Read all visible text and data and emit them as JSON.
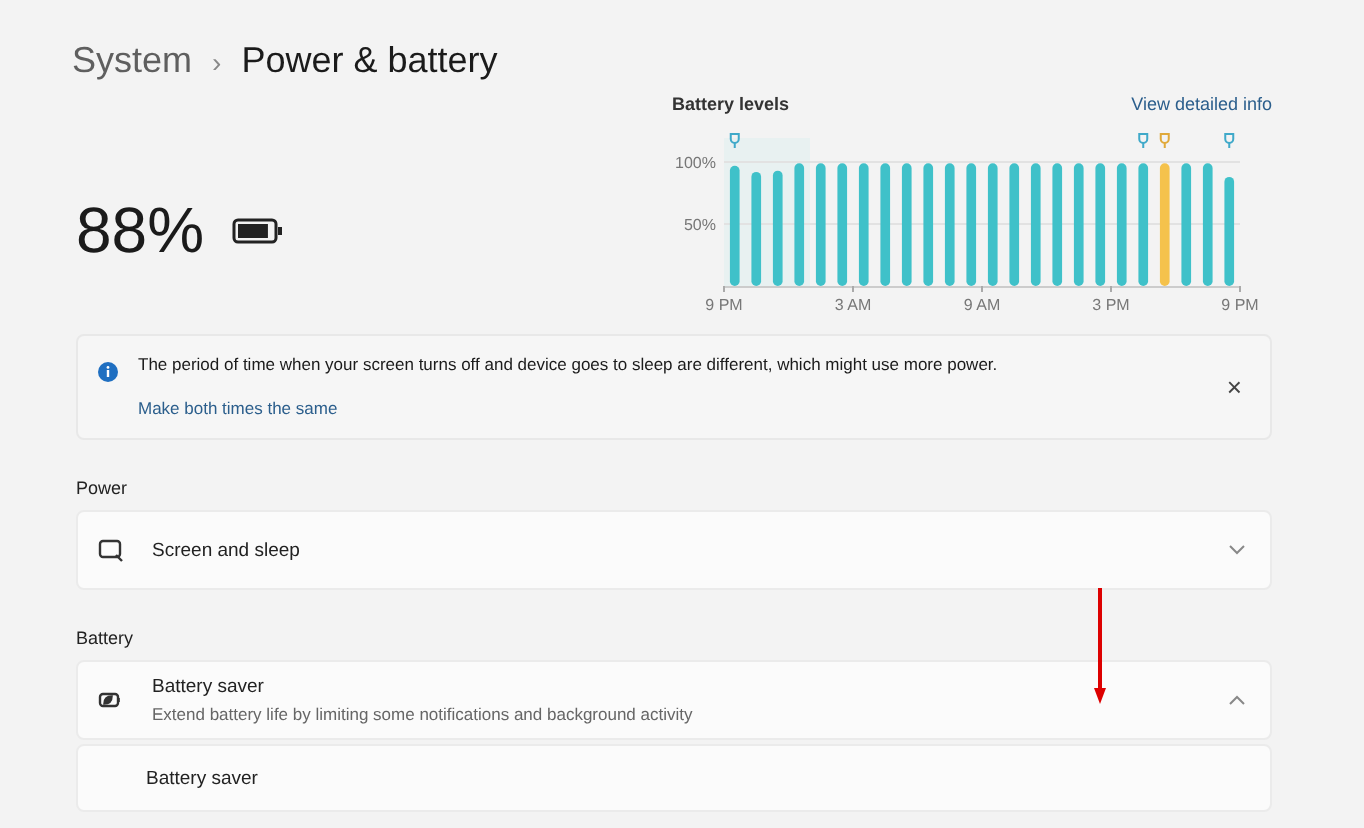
{
  "breadcrumb": {
    "parent": "System",
    "separator": "›",
    "current": "Power & battery"
  },
  "battery": {
    "percent": "88%",
    "level": 0.88
  },
  "battery_levels": {
    "title": "Battery levels",
    "link": "View detailed info",
    "chart_data": {
      "type": "bar",
      "yticks": [
        {
          "value": 50,
          "label": "50%"
        },
        {
          "value": 100,
          "label": "100%"
        }
      ],
      "ylim": [
        0,
        100
      ],
      "categories": [
        "9 PM",
        null,
        null,
        null,
        null,
        null,
        "3 AM",
        null,
        null,
        null,
        null,
        null,
        "9 AM",
        null,
        null,
        null,
        null,
        null,
        "3 PM",
        null,
        null,
        null,
        null,
        null,
        "9 PM"
      ],
      "series": [
        {
          "color": "#3fc1c9",
          "values": [
            97,
            92,
            93,
            99,
            99,
            99,
            99,
            99,
            99,
            99,
            99,
            99,
            99,
            99,
            99,
            99,
            99,
            99,
            99,
            99,
            null,
            99,
            99,
            88,
            null
          ]
        },
        {
          "color": "#f5c24c",
          "values": [
            null,
            null,
            null,
            null,
            null,
            null,
            null,
            null,
            null,
            null,
            null,
            null,
            null,
            null,
            null,
            null,
            null,
            null,
            null,
            null,
            99,
            null,
            null,
            null,
            null
          ]
        }
      ]
    },
    "bars": [
      {
        "charging": true
      },
      {
        "charging": false
      },
      {
        "charging": false
      },
      {
        "charging": false
      },
      {
        "charging": false
      },
      {
        "charging": false
      },
      {
        "charging": false
      },
      {
        "charging": false
      },
      {
        "charging": false
      },
      {
        "charging": false
      },
      {
        "charging": false
      },
      {
        "charging": false
      },
      {
        "charging": false
      },
      {
        "charging": false
      },
      {
        "charging": false
      },
      {
        "charging": false
      },
      {
        "charging": false
      },
      {
        "charging": false
      },
      {
        "charging": false
      },
      {
        "charging": true
      },
      {
        "charging": true
      },
      {
        "charging": false
      },
      {
        "charging": false
      },
      {
        "charging": true
      }
    ]
  },
  "notice": {
    "message": "The period of time when your screen turns off and device goes to sleep are different, which might use more power.",
    "action": "Make both times the same",
    "close": "×"
  },
  "sections": [
    {
      "heading": "Power",
      "rows": [
        {
          "kind": "expander",
          "title": "Screen and sleep",
          "expanded": false
        }
      ]
    },
    {
      "heading": "Battery",
      "rows": [
        {
          "kind": "expander",
          "title": "Battery saver",
          "subtitle": "Extend battery life by limiting some notifications and background activity",
          "expanded": true
        },
        {
          "kind": "sub",
          "title": "Battery saver"
        }
      ]
    }
  ]
}
